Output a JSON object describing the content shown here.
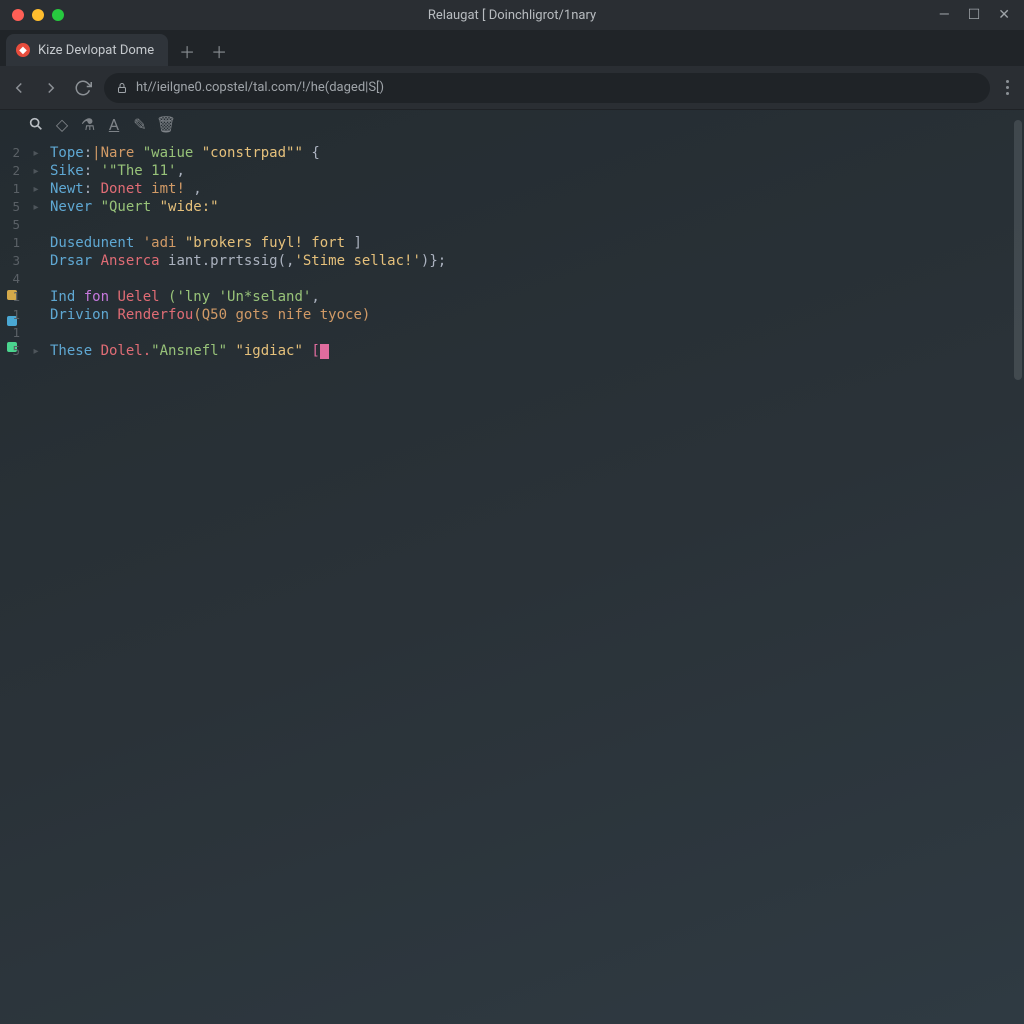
{
  "window": {
    "title": "Relaugat [ Doinchligrot/1nary"
  },
  "tabs": {
    "active": {
      "label": "Kize Devlopat Dome"
    }
  },
  "urlbar": {
    "url": "ht//ieilgne0.copstel/tal.com/!/he(daged|S[)"
  },
  "gutter": [
    "2",
    "2",
    "1",
    "5",
    "5",
    "1",
    "3",
    "4",
    "1",
    "1",
    "",
    "1",
    "5"
  ],
  "code": {
    "lines": [
      [
        {
          "t": "Tope",
          "c": "tok-key"
        },
        {
          "t": ":",
          "c": "tok-punc"
        },
        {
          "t": "|Nare ",
          "c": "tok-key2"
        },
        {
          "t": "\"waiue ",
          "c": "tok-str"
        },
        {
          "t": "\"constrpad\"\"",
          "c": "tok-str2"
        },
        {
          "t": " {",
          "c": "tok-punc"
        }
      ],
      [
        {
          "t": "Sike",
          "c": "tok-key"
        },
        {
          "t": ": ",
          "c": "tok-punc"
        },
        {
          "t": "'\"The 11'",
          "c": "tok-str"
        },
        {
          "t": ",",
          "c": "tok-punc"
        }
      ],
      [
        {
          "t": "Newt",
          "c": "tok-key"
        },
        {
          "t": ": ",
          "c": "tok-punc"
        },
        {
          "t": "Donet ",
          "c": "tok-red"
        },
        {
          "t": "imt!",
          "c": "tok-key2"
        },
        {
          "t": " ,",
          "c": "tok-punc"
        }
      ],
      [
        {
          "t": "Never ",
          "c": "tok-key"
        },
        {
          "t": "\"Quert ",
          "c": "tok-str"
        },
        {
          "t": "\"wide:\"",
          "c": "tok-str2"
        }
      ],
      [
        {
          "t": "",
          "c": ""
        }
      ],
      [
        {
          "t": "Dusedunent ",
          "c": "tok-key"
        },
        {
          "t": "'adi ",
          "c": "tok-key2"
        },
        {
          "t": "\"brokers fuyl! fort ",
          "c": "tok-str2"
        },
        {
          "t": "]",
          "c": "tok-punc"
        }
      ],
      [
        {
          "t": "Drsar ",
          "c": "tok-key"
        },
        {
          "t": "Anserca ",
          "c": "tok-red"
        },
        {
          "t": "iant.prrtssig(,",
          "c": "tok-punc"
        },
        {
          "t": "'Stime sellac!'",
          "c": "tok-str2"
        },
        {
          "t": ")};",
          "c": "tok-punc"
        }
      ],
      [
        {
          "t": "",
          "c": ""
        }
      ],
      [
        {
          "t": "Ind ",
          "c": "tok-key"
        },
        {
          "t": "fon ",
          "c": "tok-var"
        },
        {
          "t": "Uelel ",
          "c": "tok-red"
        },
        {
          "t": "('lny 'Un*seland'",
          "c": "tok-str"
        },
        {
          "t": ",",
          "c": "tok-punc"
        }
      ],
      [
        {
          "t": "Drivion ",
          "c": "tok-key"
        },
        {
          "t": "Renderfou",
          "c": "tok-red"
        },
        {
          "t": "(Q50 gots nife tyoce)",
          "c": "tok-key2"
        }
      ],
      [
        {
          "t": "",
          "c": ""
        }
      ],
      [
        {
          "t": "These ",
          "c": "tok-key"
        },
        {
          "t": "Dolel.",
          "c": "tok-red"
        },
        {
          "t": "\"Ansnefl\" ",
          "c": "tok-str"
        },
        {
          "t": "\"igdiac\" ",
          "c": "tok-str2"
        },
        {
          "t": "[",
          "c": "tok-pink"
        },
        {
          "t": "CURSOR",
          "c": "cursor"
        }
      ]
    ]
  }
}
